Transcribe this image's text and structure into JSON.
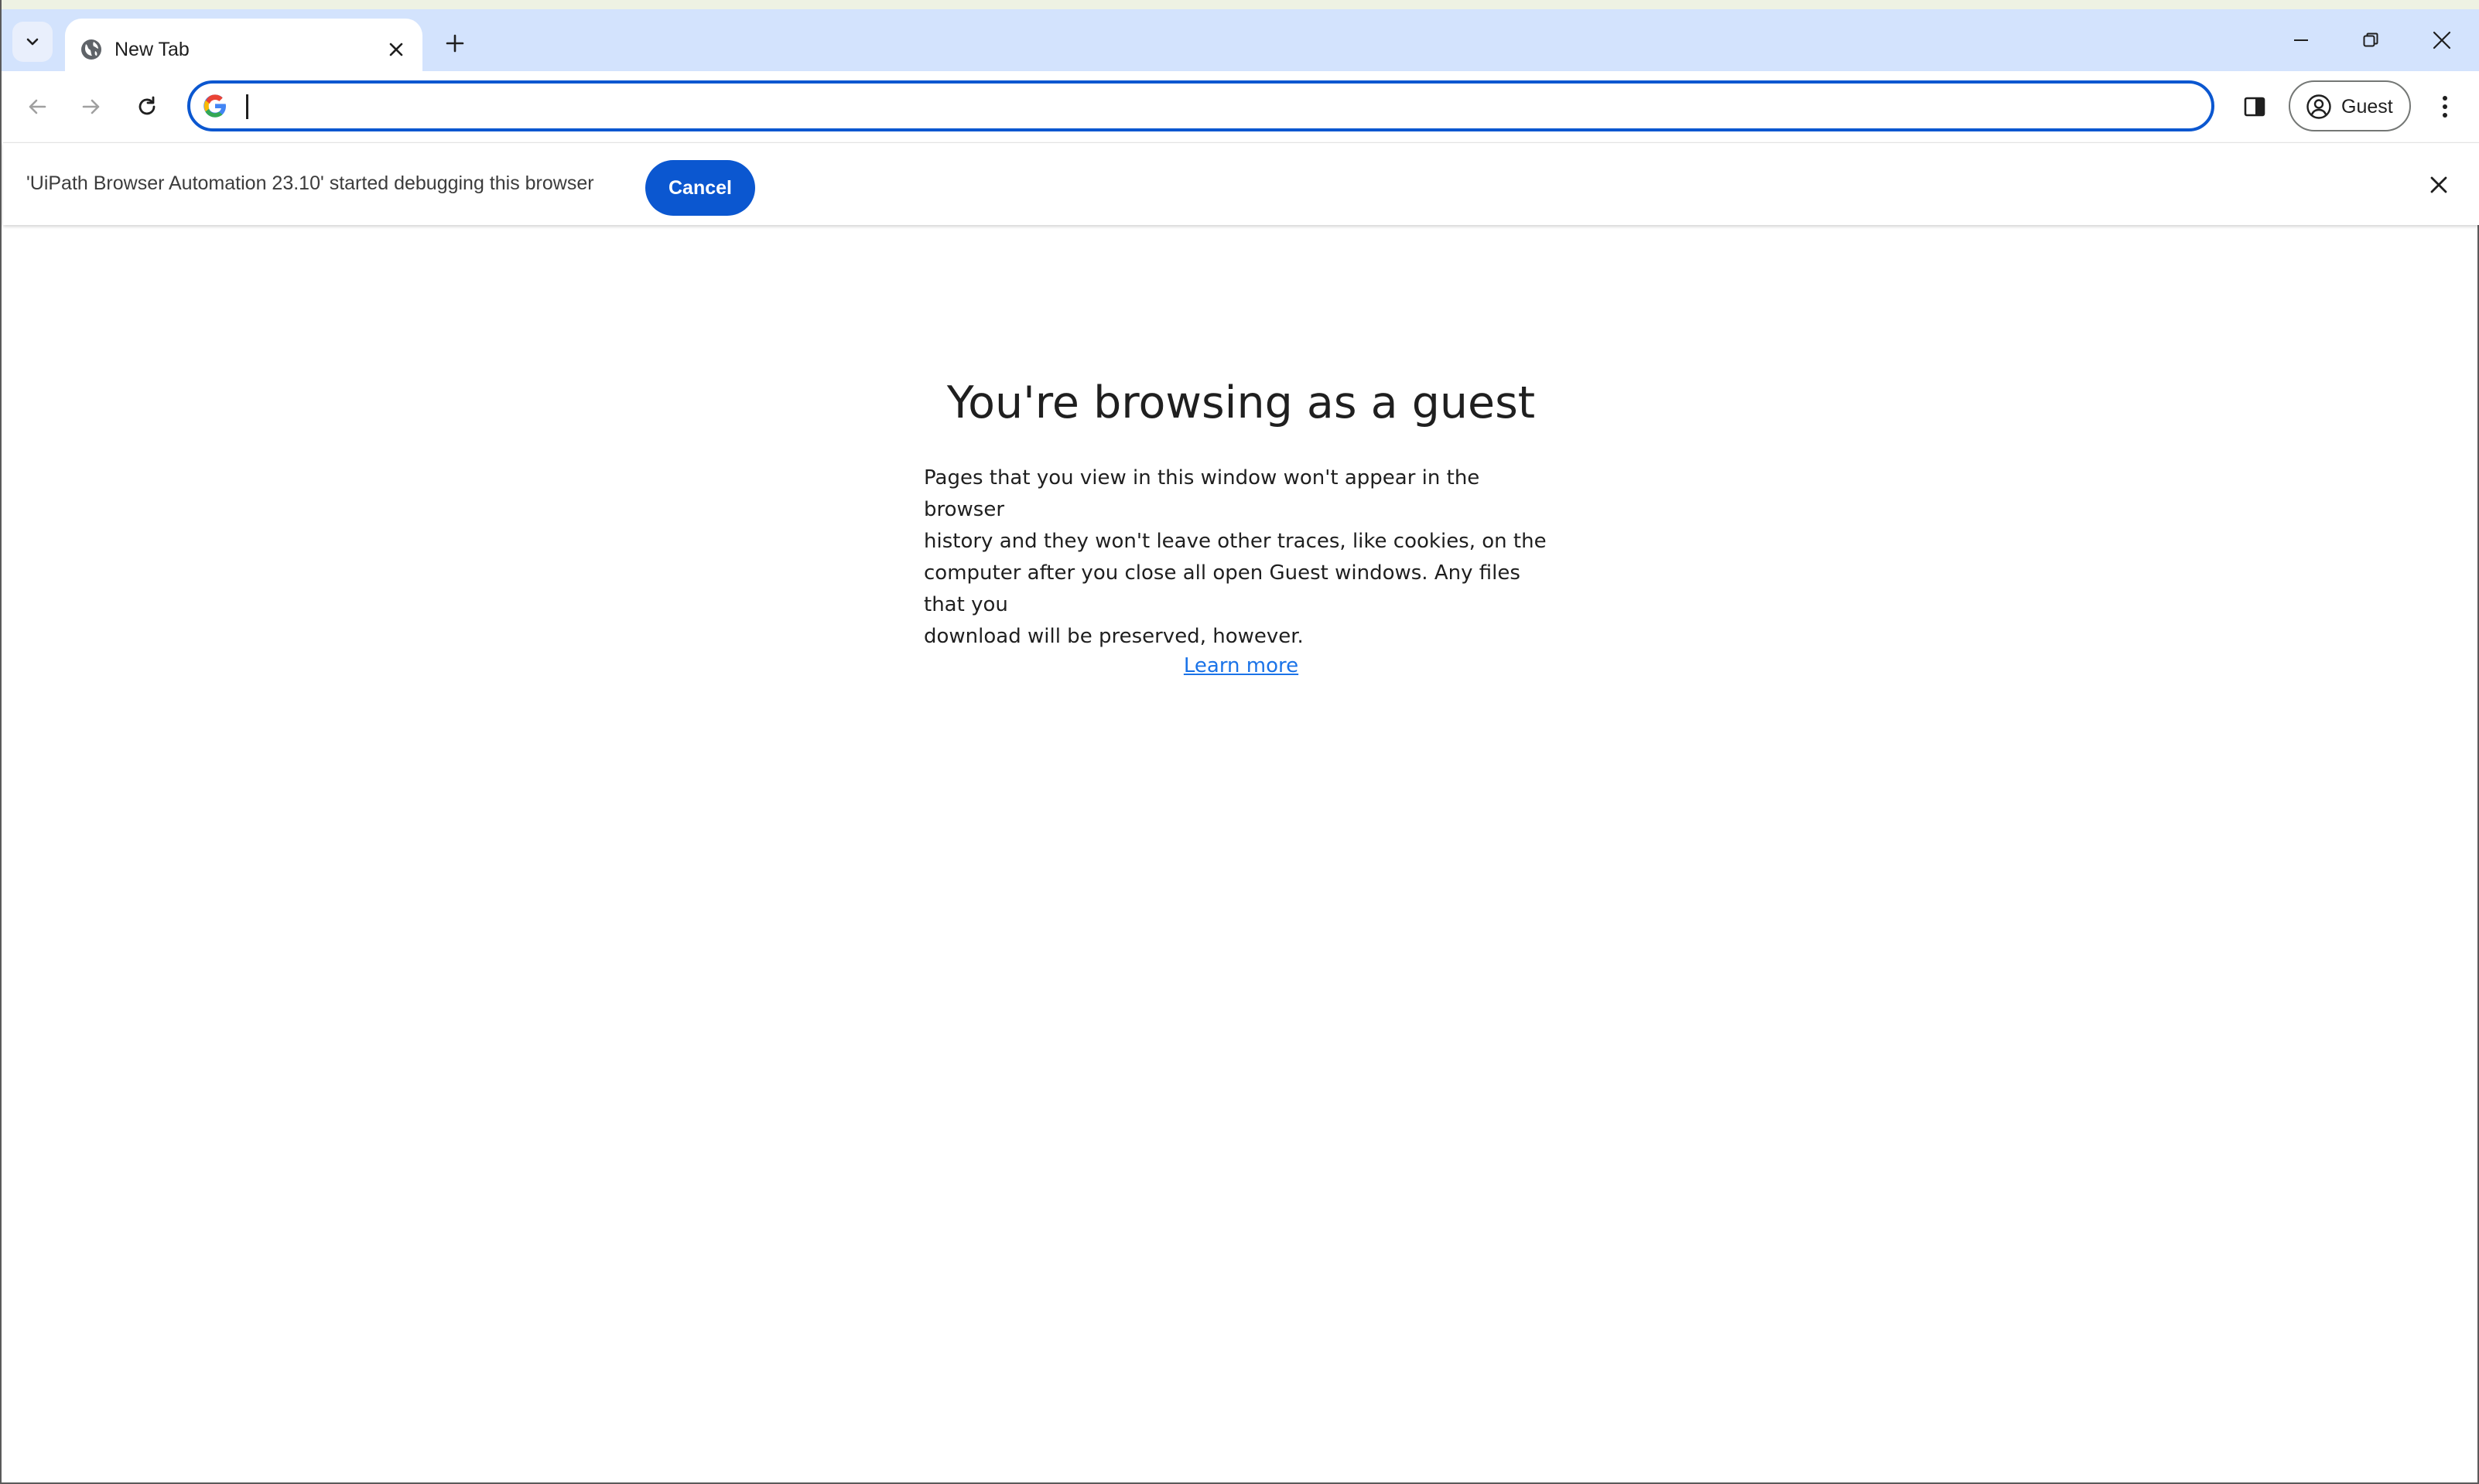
{
  "browser": {
    "tab": {
      "title": "New Tab",
      "favicon": "globe-icon"
    },
    "toolbar": {
      "omnibox_value": "",
      "omnibox_icon": "google-g-icon",
      "profile_label": "Guest"
    },
    "infobar": {
      "message": "'UiPath Browser Automation 23.10' started debugging this browser",
      "cancel_label": "Cancel"
    }
  },
  "page": {
    "headline": "You're browsing as a guest",
    "body_lines": [
      "Pages that you view in this window won't appear in the browser",
      "history and they won't leave other traces, like cookies, on the",
      "computer after you close all open Guest windows. Any files that you",
      "download will be preserved, however."
    ],
    "learn_more": "Learn more"
  },
  "colors": {
    "accent": "#0b57d0",
    "tabstrip": "#d3e3fd",
    "link": "#1a73e8"
  }
}
